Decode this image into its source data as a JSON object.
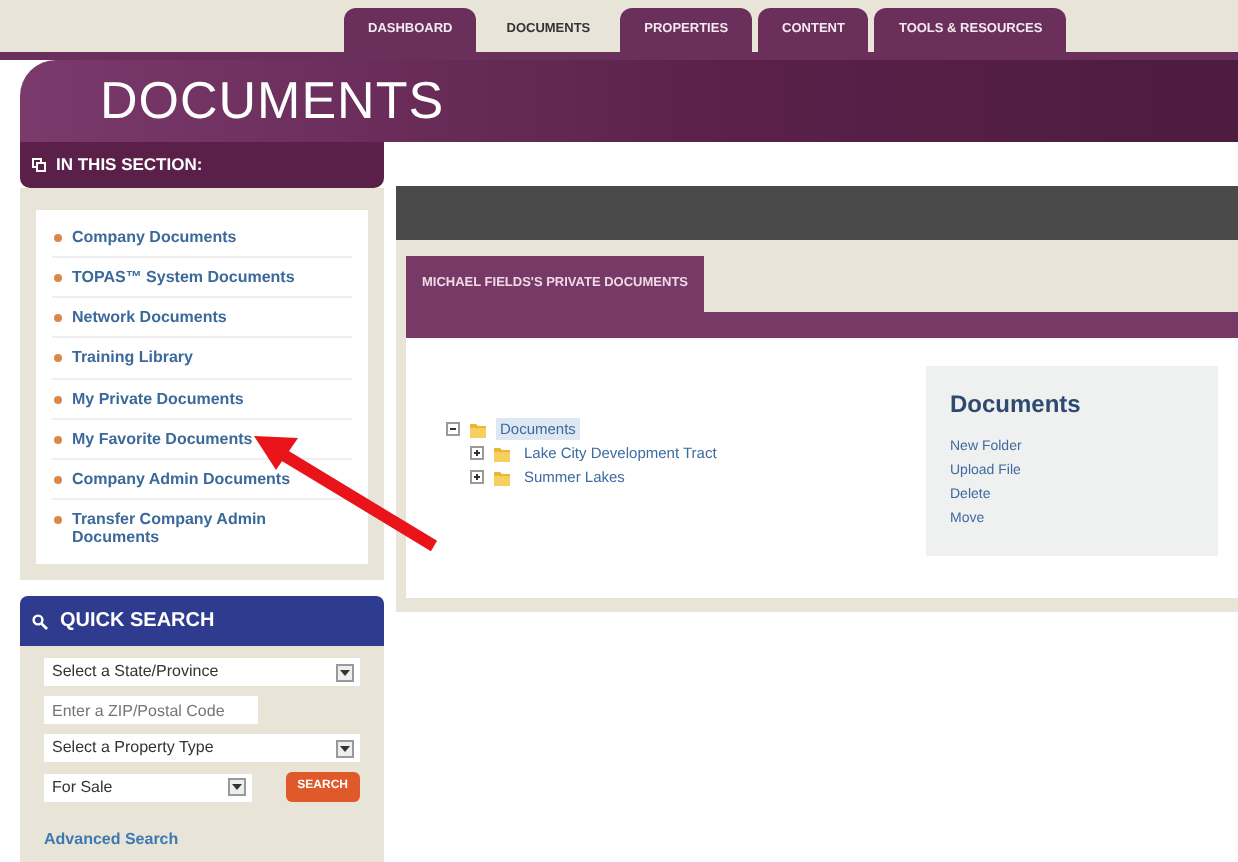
{
  "tabs": [
    {
      "label": "DASHBOARD",
      "selected": false
    },
    {
      "label": "DOCUMENTS",
      "selected": true
    },
    {
      "label": "PROPERTIES",
      "selected": false
    },
    {
      "label": "CONTENT",
      "selected": false
    },
    {
      "label": "TOOLS & RESOURCES",
      "selected": false
    }
  ],
  "page_title": "DOCUMENTS",
  "section": {
    "title": "IN THIS SECTION:",
    "items": [
      "Company Documents",
      "TOPAS™ System Documents",
      "Network Documents",
      "Training Library",
      "My Private Documents",
      "My Favorite Documents",
      "Company Admin Documents",
      "Transfer Company Admin Documents"
    ]
  },
  "quick_search": {
    "title": "QUICK SEARCH",
    "fields": [
      {
        "kind": "select",
        "value": "Select a State/Province"
      },
      {
        "kind": "input",
        "placeholder": "Enter a ZIP/Postal Code"
      },
      {
        "kind": "select",
        "value": "Select a Property Type"
      }
    ],
    "sale_select": "For Sale",
    "button": "SEARCH",
    "link": "Advanced Search"
  },
  "panel": {
    "tab": "MICHAEL FIELDS'S PRIVATE DOCUMENTS",
    "tree": [
      {
        "label": "Documents",
        "expanded": true,
        "selected": true,
        "children": [
          {
            "label": "Lake City Development Tract",
            "expanded": false,
            "selected": false
          },
          {
            "label": "Summer Lakes",
            "expanded": false,
            "selected": false
          }
        ]
      }
    ],
    "actions": {
      "title": "Documents",
      "links": [
        "New Folder",
        "Upload File",
        "Delete",
        "Move"
      ]
    }
  }
}
